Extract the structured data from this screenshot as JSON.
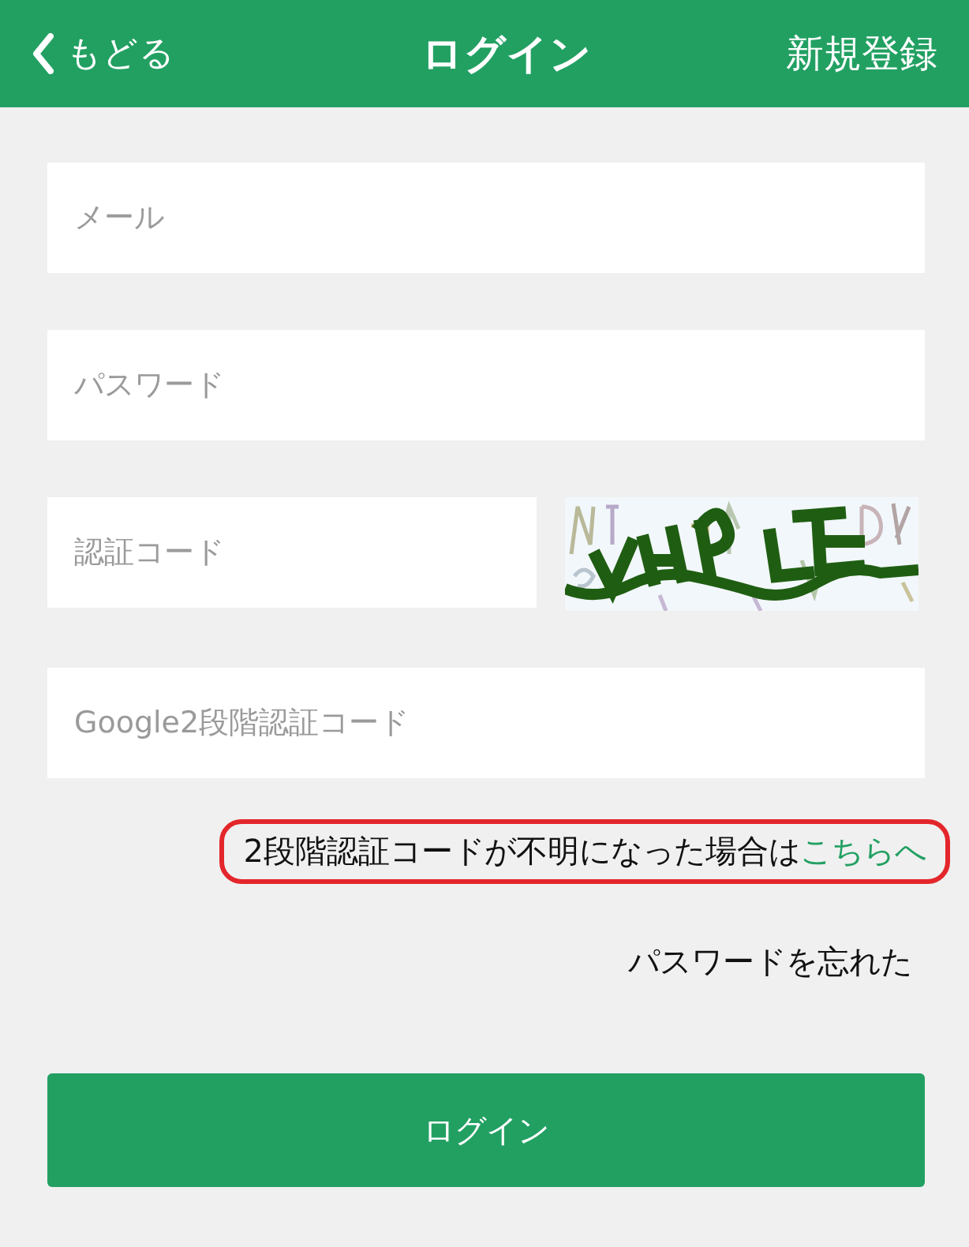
{
  "header": {
    "back_label": "もどる",
    "title": "ログイン",
    "register_label": "新規登録"
  },
  "fields": [
    {
      "kind": "email",
      "placeholder": "メール"
    },
    {
      "kind": "password",
      "placeholder": "パスワード"
    },
    {
      "kind": "captcha",
      "placeholder": "認証コード"
    },
    {
      "kind": "code",
      "placeholder": "Google2段階認証コード"
    }
  ],
  "help": {
    "highlighted": true,
    "text": "2段階認証コードが不明になった場合は",
    "link": "こちらへ"
  },
  "forgot_password": "パスワードを忘れた",
  "login_button": "ログイン"
}
